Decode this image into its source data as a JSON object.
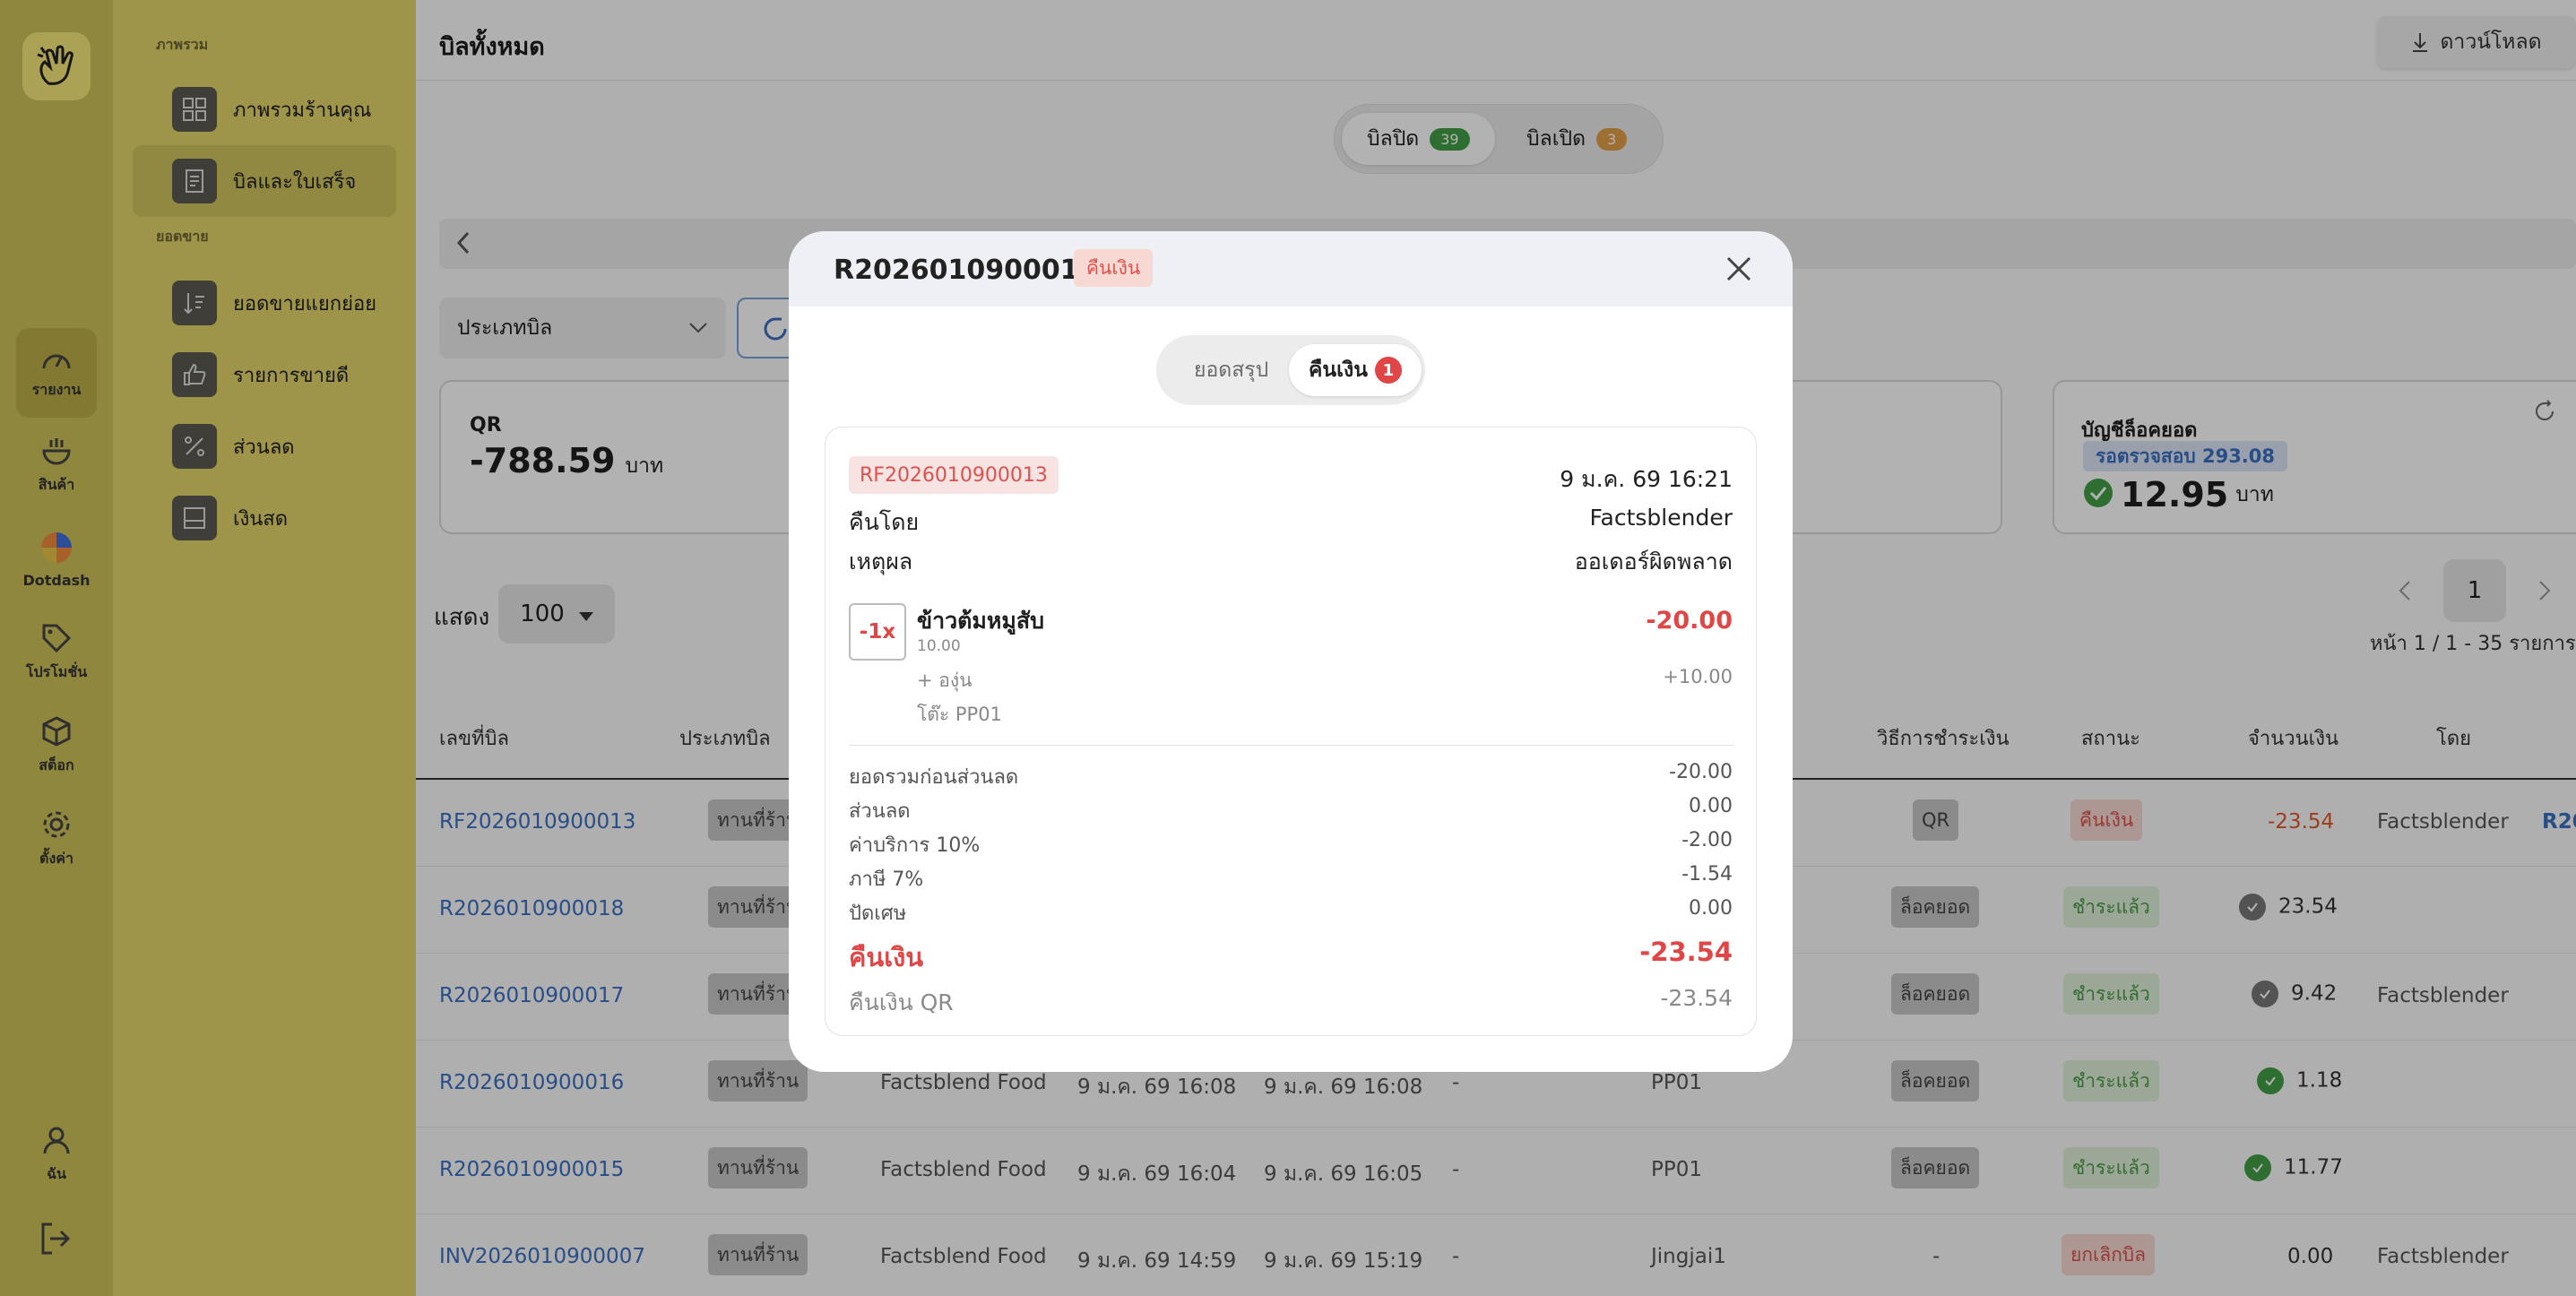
{
  "rail": {
    "items": [
      {
        "label": "รายงาน",
        "icon": "gauge-icon"
      },
      {
        "label": "สินค้า",
        "icon": "food-bowl-icon"
      },
      {
        "label": "Dotdash",
        "icon": "dotdash-logo-icon"
      },
      {
        "label": "โปรโมชั่น",
        "icon": "tag-icon"
      },
      {
        "label": "สต็อก",
        "icon": "box-icon"
      },
      {
        "label": "ตั้งค่า",
        "icon": "gear-icon"
      },
      {
        "label": "ฉัน",
        "icon": "user-icon"
      }
    ],
    "logout_icon": "logout-icon"
  },
  "submenu": {
    "section_overview": "ภาพรวม",
    "section_sales": "ยอดขาย",
    "items": [
      {
        "label": "ภาพรวมร้านคุณ",
        "icon": "dashboard-grid-icon"
      },
      {
        "label": "บิลและใบเสร็จ",
        "icon": "receipt-icon"
      },
      {
        "label": "ยอดขายแยกย่อย",
        "icon": "sort-list-icon"
      },
      {
        "label": "รายการขายดี",
        "icon": "thumbs-up-icon"
      },
      {
        "label": "ส่วนลด",
        "icon": "percent-icon"
      },
      {
        "label": "เงินสด",
        "icon": "cash-drawer-icon"
      }
    ]
  },
  "main": {
    "title": "บิลทั้งหมด",
    "download_label": "ดาวน์โหลด",
    "tabs": [
      {
        "label": "บิลปิด",
        "count": "39"
      },
      {
        "label": "บิลเปิด",
        "count": "3"
      }
    ],
    "bill_type_placeholder": "ประเภทบิล",
    "cards": {
      "qr": {
        "label": "QR",
        "amount": "-788.59",
        "unit": "บาท"
      },
      "locked": {
        "label": "บัญชีล็อคยอด",
        "pending": "รอตรวจสอบ 293.08",
        "amount": "12.95",
        "unit": "บาท"
      }
    },
    "show_label": "แสดง",
    "page_size": "100",
    "page_current": "1",
    "page_info": "หน้า 1 / 1 - 35 รายการ",
    "columns": [
      "เลขที่บิล",
      "ประเภทบิล",
      "วิธีการชำระเงิน",
      "สถานะ",
      "จำนวนเงิน",
      "โดย"
    ],
    "rows": [
      {
        "bill": "RF2026010900013",
        "type": "ทานที่ร้าน",
        "brand": "",
        "opened": "",
        "closed": "",
        "dash": "",
        "table": "",
        "method": "QR",
        "status": "คืนเงิน",
        "amount": "-23.54",
        "by": "Factsblender",
        "ref": "R20"
      },
      {
        "bill": "R2026010900018",
        "type": "ทานที่ร้าน",
        "brand": "",
        "opened": "",
        "closed": "",
        "dash": "",
        "table": "",
        "method": "ล็อคยอด",
        "status": "ชำระแล้ว",
        "amount": "23.54",
        "by": "",
        "ref": ""
      },
      {
        "bill": "R2026010900017",
        "type": "ทานที่ร้าน",
        "brand": "",
        "opened": "",
        "closed": "",
        "dash": "",
        "table": "",
        "method": "ล็อคยอด",
        "status": "ชำระแล้ว",
        "amount": "9.42",
        "by": "Factsblender",
        "ref": ""
      },
      {
        "bill": "R2026010900016",
        "type": "ทานที่ร้าน",
        "brand": "Factsblend Food",
        "opened": "9 ม.ค. 69 16:08",
        "closed": "9 ม.ค. 69 16:08",
        "dash": "-",
        "table": "PP01",
        "method": "ล็อคยอด",
        "status": "ชำระแล้ว",
        "amount": "1.18",
        "by": "",
        "ref": ""
      },
      {
        "bill": "R2026010900015",
        "type": "ทานที่ร้าน",
        "brand": "Factsblend Food",
        "opened": "9 ม.ค. 69 16:04",
        "closed": "9 ม.ค. 69 16:05",
        "dash": "-",
        "table": "PP01",
        "method": "ล็อคยอด",
        "status": "ชำระแล้ว",
        "amount": "11.77",
        "by": "",
        "ref": ""
      },
      {
        "bill": "INV2026010900007",
        "type": "ทานที่ร้าน",
        "brand": "Factsblend Food",
        "opened": "9 ม.ค. 69 14:59",
        "closed": "9 ม.ค. 69 15:19",
        "dash": "-",
        "table": "Jingjai1",
        "method": "-",
        "status": "ยกเลิกบิล",
        "amount": "0.00",
        "by": "Factsblender",
        "ref": ""
      }
    ]
  },
  "modal": {
    "title": "R2026010900018",
    "badge": "คืนเงิน",
    "tabs": [
      {
        "label": "ยอดสรุป"
      },
      {
        "label": "คืนเงิน",
        "count": "1"
      }
    ],
    "refund": {
      "id": "RF2026010900013",
      "datetime": "9 ม.ค. 69 16:21",
      "by_label": "คืนโดย",
      "by_value": "Factsblender",
      "reason_label": "เหตุผล",
      "reason_value": "ออเดอร์ผิดพลาด",
      "item": {
        "qty": "-1x",
        "name": "ข้าวต้มหมูสับ",
        "price": "10.00",
        "total": "-20.00",
        "addon": "+ องุ่น",
        "addon_price": "+10.00",
        "table": "โต๊ะ PP01"
      },
      "summary": [
        {
          "label": "ยอดรวมก่อนส่วนลด",
          "value": "-20.00"
        },
        {
          "label": "ส่วนลด",
          "value": "0.00"
        },
        {
          "label": "ค่าบริการ 10%",
          "value": "-2.00"
        },
        {
          "label": "ภาษี 7%",
          "value": "-1.54"
        },
        {
          "label": "ปัดเศษ",
          "value": "0.00"
        }
      ],
      "total_label": "คืนเงิน",
      "total_value": "-23.54",
      "method_label": "คืนเงิน QR",
      "method_value": "-23.54"
    }
  },
  "colors": {
    "rail": "#cfc259",
    "submenu": "#e2d56a",
    "accent_red": "#e04646",
    "link_blue": "#3b6fc1",
    "paid_green": "#4c9a45"
  }
}
